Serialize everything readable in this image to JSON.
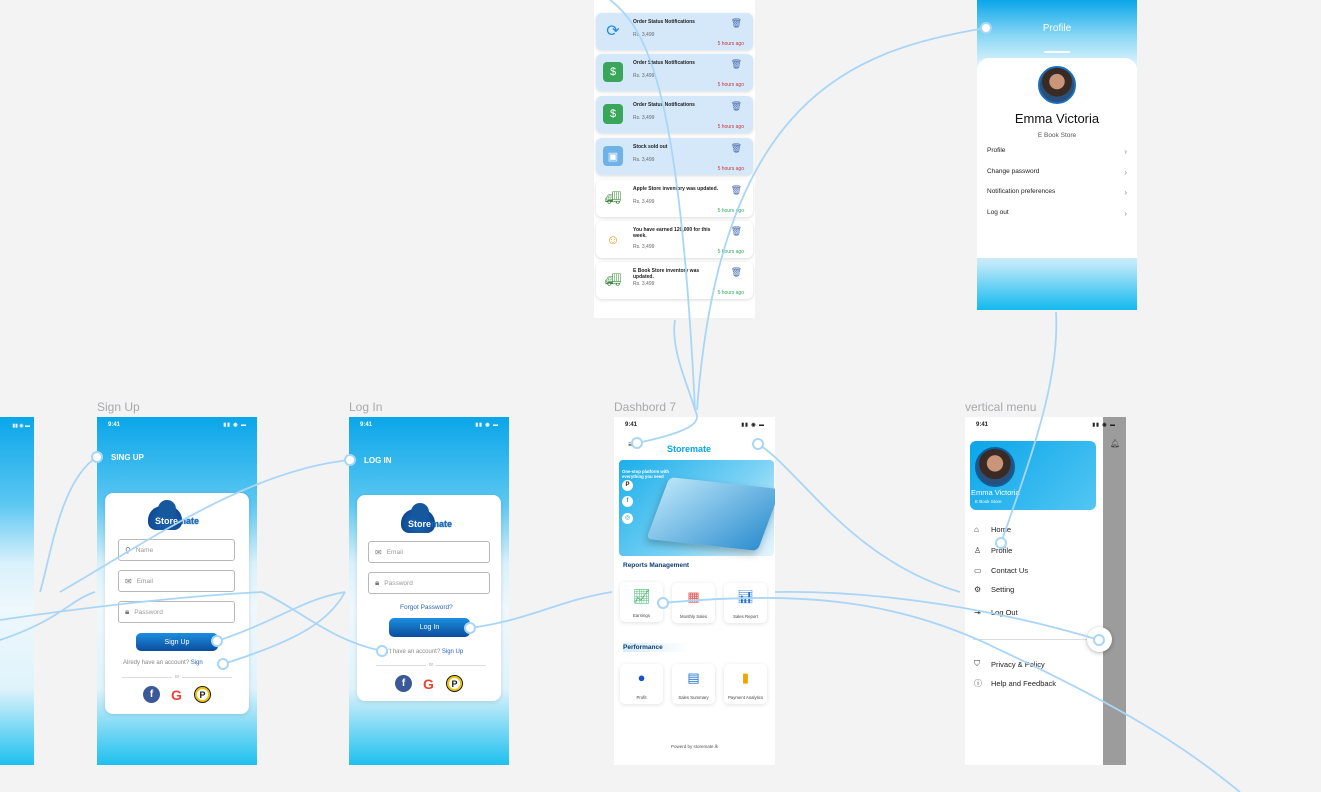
{
  "frames": {
    "signup_label": "Sign Up",
    "login_label": "Log In",
    "dashboard_label": "Dashbord 7",
    "vmenu_label": "vertical menu"
  },
  "status": {
    "time": "9:41"
  },
  "notifications": {
    "items": [
      {
        "title": "Order Status Notifications",
        "price": "Rs. 3,499",
        "time": "5 hours ago",
        "icon": "refresh-icon"
      },
      {
        "title": "Order Status Notifications",
        "price": "Rs. 3,499",
        "time": "5 hours ago",
        "icon": "money-bag-icon"
      },
      {
        "title": "Order Status Notifications",
        "price": "Rs. 3,499",
        "time": "5 hours ago",
        "icon": "money-bag-icon"
      },
      {
        "title": "Stock sold out",
        "price": "Rs. 3,499",
        "time": "5 hours ago",
        "icon": "box-icon"
      },
      {
        "title": "Apple Store inventory was updated.",
        "price": "Rs. 3,499",
        "time": "5 hours ago",
        "icon": "truck-icon"
      },
      {
        "title": "You have earned 120,000 for this week.",
        "price": "Rs. 3,499",
        "time": "5 hours ago",
        "icon": "person-icon"
      },
      {
        "title": "E Book Store inventory was updated.",
        "price": "Rs. 3,499",
        "time": "5 hours ago",
        "icon": "truck-icon"
      }
    ]
  },
  "profile": {
    "title": "Profile",
    "name": "Emma Victoria",
    "store": "E Book Store",
    "menu": [
      "Profile",
      "Change password",
      "Notification preferences",
      "Log out"
    ]
  },
  "signup": {
    "header": "SING UP",
    "logo_a": "Store",
    "logo_b": "mate",
    "name_placeholder": "Name",
    "email_placeholder": "Email",
    "password_placeholder": "Password",
    "button": "Sign Up",
    "already": "Alredy have an account?",
    "signin_link": "Sign",
    "or": "or"
  },
  "login": {
    "header": "LOG IN",
    "logo_a": "Store",
    "logo_b": "mate",
    "email_placeholder": "Email",
    "password_placeholder": "Password",
    "forgot": "Forgot Password?",
    "button": "Log In",
    "no_account": "n't have an account?",
    "signup_link": "Sign Up",
    "or": "or"
  },
  "dashboard": {
    "brand": "Storemate",
    "banner_text": "One-stop platform with everything you need",
    "reports_title": "Reports Management",
    "reports": [
      "Earnings",
      "Monthly Sales",
      "Sales Report"
    ],
    "performance_title": "Performance",
    "performance": [
      "Profit",
      "Sales Summary",
      "Payment Analytics"
    ],
    "footer": "Powerd by storemate.lk"
  },
  "vmenu": {
    "name": "Emma Victoria",
    "store": "E Book Store",
    "items": [
      "Home",
      "Profile",
      "Contact Us",
      "Setting",
      "Log Out"
    ],
    "bottom_items": [
      "Privacy & Policy",
      "Help and Feedback"
    ]
  },
  "colors": {
    "accent": "#0aa6e9",
    "button": "#0c4d9c",
    "flow": "#a9d6f7",
    "danger": "#d0343a",
    "success": "#2fae5d"
  }
}
